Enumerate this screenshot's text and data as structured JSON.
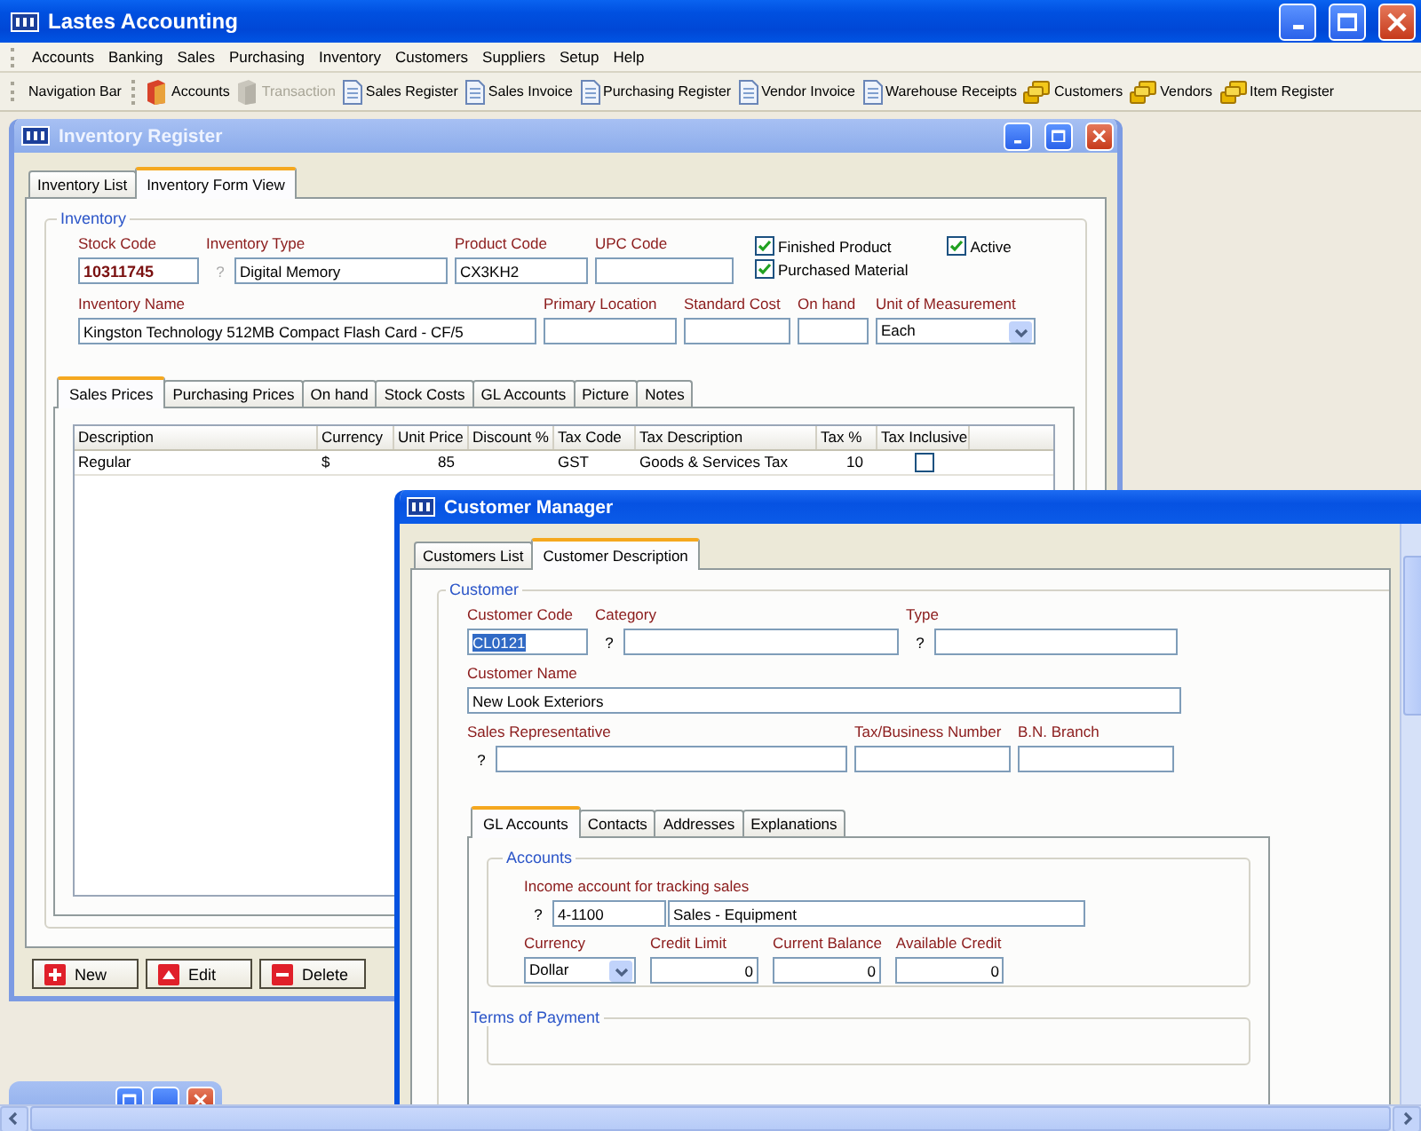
{
  "app": {
    "title": "Lastes Accounting"
  },
  "menu": [
    "Accounts",
    "Banking",
    "Sales",
    "Purchasing",
    "Inventory",
    "Customers",
    "Suppliers",
    "Setup",
    "Help"
  ],
  "toolbar": {
    "label": "Navigation Bar",
    "items": [
      {
        "label": "Accounts",
        "kind": "book",
        "disabled": false
      },
      {
        "label": "Transaction",
        "kind": "book",
        "disabled": true
      },
      {
        "label": "Sales Register",
        "kind": "document",
        "disabled": false
      },
      {
        "label": "Sales Invoice",
        "kind": "document",
        "disabled": false
      },
      {
        "label": "Purchasing Register",
        "kind": "document",
        "disabled": false
      },
      {
        "label": "Vendor Invoice",
        "kind": "document",
        "disabled": false
      },
      {
        "label": "Warehouse Receipts",
        "kind": "document",
        "disabled": false
      },
      {
        "label": "Customers",
        "kind": "coins",
        "disabled": false
      },
      {
        "label": "Vendors",
        "kind": "coins",
        "disabled": false
      },
      {
        "label": "Item Register",
        "kind": "coins",
        "disabled": false
      }
    ]
  },
  "inventory_window": {
    "title": "Inventory Register",
    "active": false,
    "tabs": [
      {
        "label": "Inventory List",
        "selected": false
      },
      {
        "label": "Inventory Form View",
        "selected": true
      }
    ],
    "group": "Inventory",
    "fields": [
      {
        "kind": "text",
        "label": "Stock Code",
        "value": "10311745",
        "bold": true
      },
      {
        "kind": "text",
        "label": "Inventory Type",
        "help": "?",
        "value": "Digital Memory"
      },
      {
        "kind": "text",
        "label": "Product Code",
        "value": "CX3KH2"
      },
      {
        "kind": "text",
        "label": "UPC Code"
      },
      {
        "kind": "checks",
        "items": [
          {
            "label": "Finished Product",
            "checked": true
          },
          {
            "label": "Purchased Material",
            "checked": true
          }
        ]
      },
      {
        "kind": "checks",
        "items": [
          {
            "label": "Active",
            "checked": true
          }
        ]
      },
      {
        "kind": "text",
        "label": "Inventory Name",
        "value": "Kingston Technology 512MB Compact Flash Card - CF/5"
      },
      {
        "kind": "text",
        "label": "Primary Location"
      },
      {
        "kind": "text",
        "label": "Standard Cost"
      },
      {
        "kind": "text",
        "label": "On hand"
      },
      {
        "kind": "select",
        "label": "Unit of Measurement",
        "value": "Each"
      }
    ],
    "subtabs": [
      {
        "label": "Sales Prices",
        "selected": true
      },
      {
        "label": "Purchasing Prices",
        "selected": false
      },
      {
        "label": "On hand",
        "selected": false
      },
      {
        "label": "Stock Costs",
        "selected": false
      },
      {
        "label": "GL Accounts",
        "selected": false
      },
      {
        "label": "Picture",
        "selected": false
      },
      {
        "label": "Notes",
        "selected": false
      }
    ],
    "grid": {
      "columns": [
        "Description",
        "Currency",
        "Unit Price",
        "Discount %",
        "Tax Code",
        "Tax Description",
        "Tax %",
        "Tax Inclusive"
      ],
      "rows": [
        {
          "cells": [
            "Regular",
            "$",
            "85",
            null,
            "GST",
            "Goods & Services Tax",
            "10"
          ],
          "tax_inclusive": false
        }
      ]
    },
    "buttons": [
      {
        "label": "New",
        "kind": "plus"
      },
      {
        "label": "Edit",
        "kind": "up"
      },
      {
        "label": "Delete",
        "kind": "minus"
      }
    ]
  },
  "customer_window": {
    "title": "Customer Manager",
    "active": true,
    "tabs": [
      {
        "label": "Customers List",
        "selected": false
      },
      {
        "label": "Customer Description",
        "selected": true
      }
    ],
    "group": "Customer",
    "fields": [
      {
        "kind": "text",
        "label": "Customer Code",
        "value": "CL0121",
        "highlighted": true
      },
      {
        "kind": "text",
        "label": "Category",
        "help": "?"
      },
      {
        "kind": "text",
        "label": "Type",
        "help": "?"
      },
      {
        "kind": "text",
        "label": "Customer Name",
        "value": "New Look Exteriors"
      },
      {
        "kind": "text",
        "label": "Sales Representative",
        "help": "?"
      },
      {
        "kind": "text",
        "label": "Tax/Business Number"
      },
      {
        "kind": "text",
        "label": "B.N. Branch"
      }
    ],
    "subtabs": [
      {
        "label": "GL Accounts",
        "selected": true
      },
      {
        "label": "Contacts",
        "selected": false
      },
      {
        "label": "Addresses",
        "selected": false
      },
      {
        "label": "Explanations",
        "selected": false
      }
    ],
    "accounts": {
      "title": "Accounts",
      "fields": [
        {
          "kind": "account",
          "label": "Income account for tracking sales",
          "help": "?",
          "code": "4-1100",
          "value": "Sales - Equipment"
        },
        {
          "kind": "select",
          "label": "Currency",
          "value": "Dollar"
        },
        {
          "kind": "number",
          "label": "Credit Limit",
          "value": "0"
        },
        {
          "kind": "number",
          "label": "Current Balance",
          "value": "0"
        },
        {
          "kind": "number",
          "label": "Available Credit",
          "value": "0"
        }
      ]
    },
    "terms_title": "Terms of Payment"
  }
}
